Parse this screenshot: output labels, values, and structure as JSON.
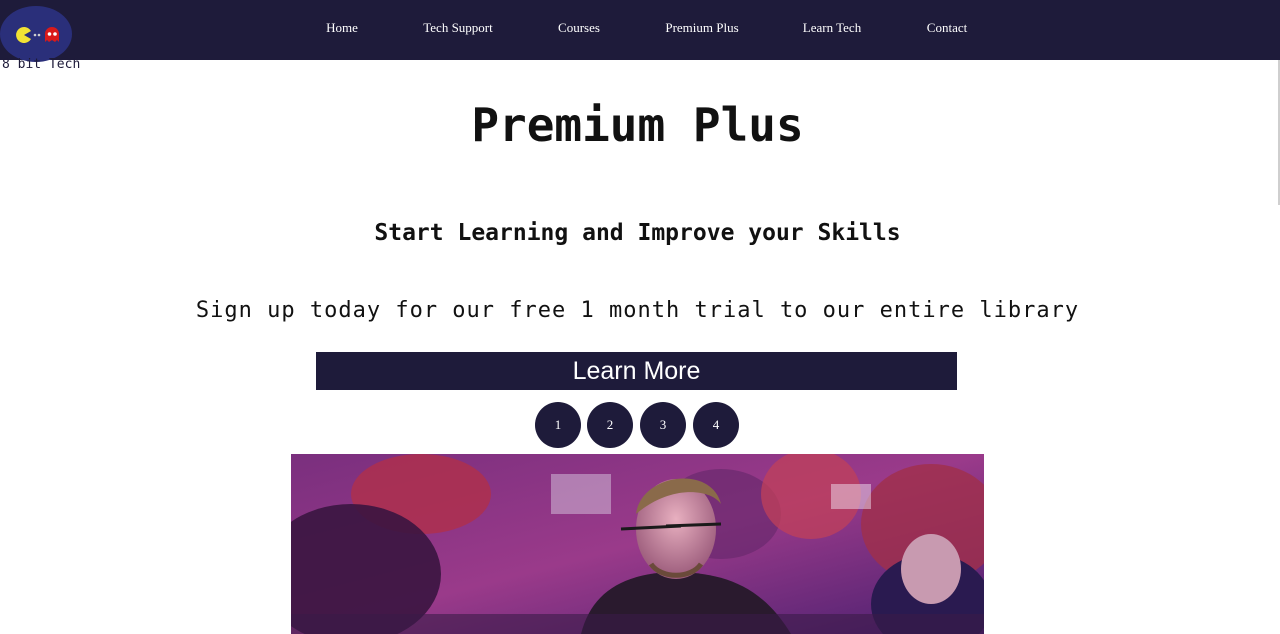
{
  "brand": {
    "logo_text": "8 bit Tech",
    "colors": {
      "navy": "#1e1b3a",
      "logo_bg": "#2a2f7a",
      "pacman": "#f2e234",
      "ghost": "#d91a1a"
    }
  },
  "nav": {
    "items": [
      {
        "label": "Home"
      },
      {
        "label": "Tech Support"
      },
      {
        "label": "Courses"
      },
      {
        "label": "Premium Plus"
      },
      {
        "label": "Learn Tech"
      },
      {
        "label": "Contact"
      }
    ]
  },
  "main": {
    "title": "Premium Plus",
    "subtitle": "Start Learning and Improve your Skills",
    "tagline": "Sign up today for our free 1 month trial to our entire library",
    "cta_label": "Learn More",
    "slides": [
      {
        "label": "1"
      },
      {
        "label": "2"
      },
      {
        "label": "3"
      },
      {
        "label": "4"
      }
    ],
    "hero_image": {
      "icon": "photo-of-people-at-computer-event"
    }
  }
}
